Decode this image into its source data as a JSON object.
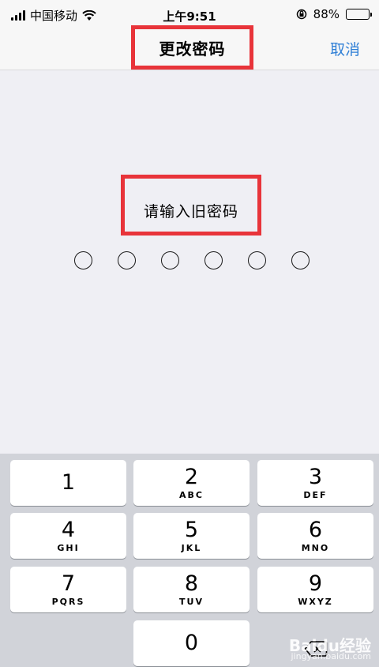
{
  "status_bar": {
    "carrier": "中国移动",
    "time": "上午9:51",
    "battery_percent": "88%",
    "battery_level": 0.88,
    "icons": [
      "signal-icon",
      "wifi-icon",
      "rotation-lock-icon",
      "battery-icon"
    ]
  },
  "nav": {
    "title": "更改密码",
    "cancel_label": "取消"
  },
  "prompt": {
    "text": "请输入旧密码",
    "passcode_length": 6
  },
  "keypad": {
    "keys": [
      {
        "num": "1",
        "letters": ""
      },
      {
        "num": "2",
        "letters": "ABC"
      },
      {
        "num": "3",
        "letters": "DEF"
      },
      {
        "num": "4",
        "letters": "GHI"
      },
      {
        "num": "5",
        "letters": "JKL"
      },
      {
        "num": "6",
        "letters": "MNO"
      },
      {
        "num": "7",
        "letters": "PQRS"
      },
      {
        "num": "8",
        "letters": "TUV"
      },
      {
        "num": "9",
        "letters": "WXYZ"
      },
      {
        "num": "0",
        "letters": ""
      }
    ]
  },
  "watermark": {
    "brand": "Baidu经验",
    "url": "jingyan.baidu.com"
  },
  "colors": {
    "accent": "#2f7fd6",
    "highlight_box": "#e8343a",
    "keypad_bg": "#d1d3d9"
  }
}
